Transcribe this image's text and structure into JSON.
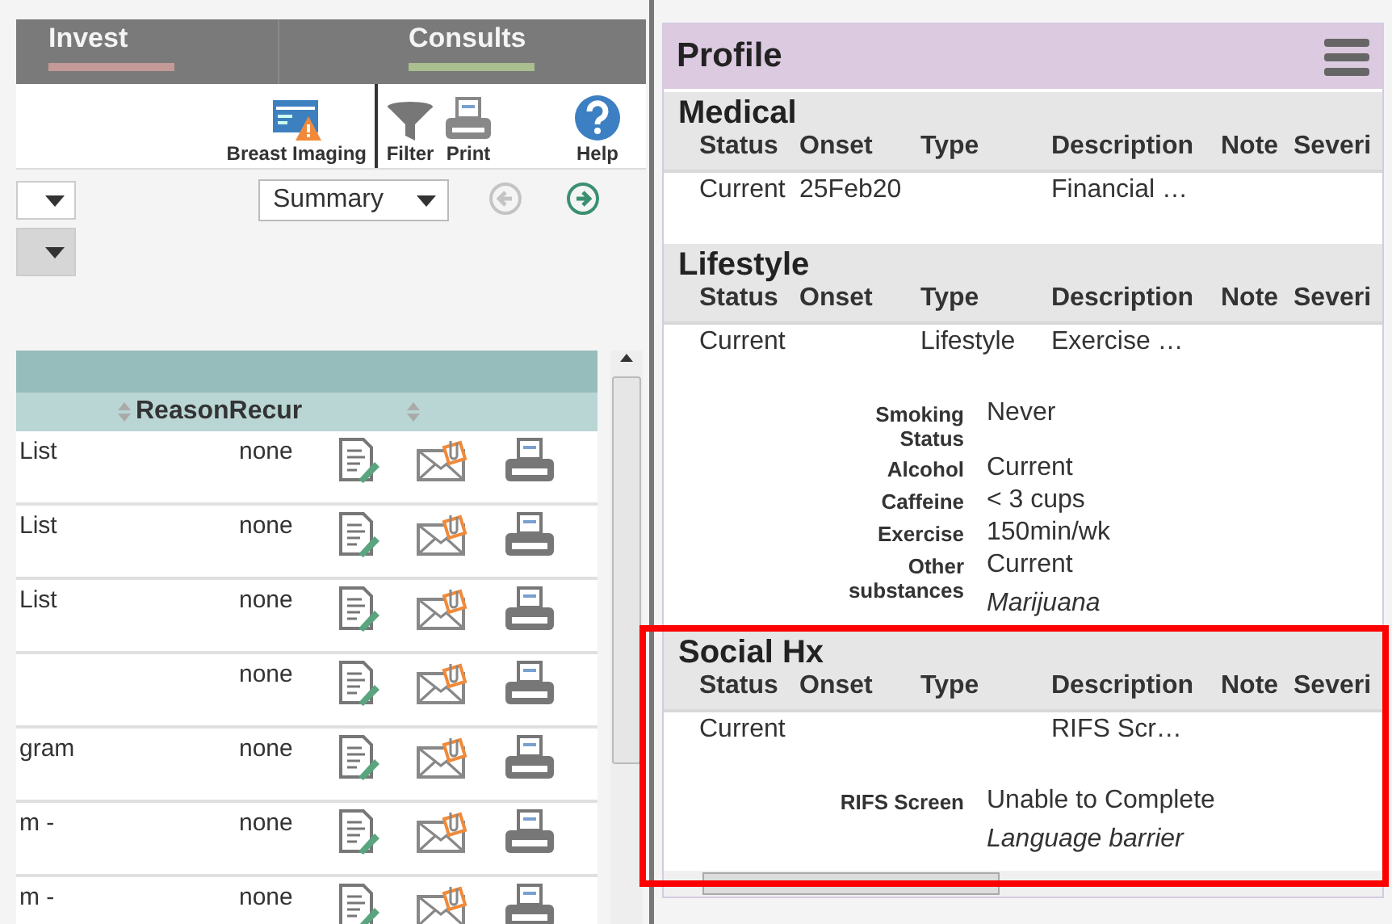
{
  "top_tabs": [
    {
      "label": "Invest",
      "color": "#c49a98"
    },
    {
      "label": "Consults",
      "color": "#a9bf8f"
    }
  ],
  "toolbar": [
    {
      "label": "Breast Imaging",
      "kind": "imaging"
    },
    {
      "label": "Filter",
      "kind": "filter"
    },
    {
      "label": "Print",
      "kind": "print"
    },
    {
      "label": "Help",
      "kind": "help"
    }
  ],
  "filter_dropdowns": [
    {
      "disabled": false
    },
    {
      "disabled": true
    }
  ],
  "view_select": {
    "value": "Summary"
  },
  "nav": [
    {
      "kind": "back",
      "disabled": true
    },
    {
      "kind": "forward",
      "disabled": false
    }
  ],
  "table": {
    "columns": [
      "ReasonRecur"
    ],
    "rows": [
      {
        "column_1": "List",
        "reason_recur": "none"
      },
      {
        "column_1": "List",
        "reason_recur": "none"
      },
      {
        "column_1": "List",
        "reason_recur": "none"
      },
      {
        "reason_recur": "none"
      },
      {
        "column_1": "gram",
        "reason_recur": "none"
      },
      {
        "column_1": "m -",
        "reason_recur": "none"
      },
      {
        "column_1": "m -",
        "reason_recur": "none"
      }
    ]
  },
  "profile": {
    "title": "Profile",
    "sections": [
      {
        "title": "Medical",
        "columns": [
          "Status",
          "Onset",
          "Type",
          "Description",
          "Note",
          "Severi"
        ],
        "rows": [
          {
            "status": "Current",
            "onset": "25Feb20",
            "description": "Financial …"
          }
        ]
      },
      {
        "title": "Lifestyle",
        "columns": [
          "Status",
          "Onset",
          "Type",
          "Description",
          "Note",
          "Severi"
        ],
        "rows": [
          {
            "status": "Current",
            "type": "Lifestyle",
            "description": "Exercise …"
          }
        ],
        "details": [
          {
            "label": "Smoking Status",
            "value": "Never"
          },
          {
            "label": "Alcohol",
            "value": "Current"
          },
          {
            "label": "Caffeine",
            "value": "< 3 cups"
          },
          {
            "label": "Exercise",
            "value": "150min/wk"
          },
          {
            "label": "Other substances",
            "value": "Current",
            "note": "Marijuana"
          }
        ]
      },
      {
        "title": "Social Hx",
        "highlighted": true,
        "columns": [
          "Status",
          "Onset",
          "Type",
          "Description",
          "Note",
          "Severi"
        ],
        "rows": [
          {
            "status": "Current",
            "description": "RIFS Scr…"
          }
        ],
        "details": [
          {
            "label": "RIFS Screen",
            "value": "Unable to Complete",
            "note": "Language barrier"
          }
        ]
      }
    ]
  }
}
